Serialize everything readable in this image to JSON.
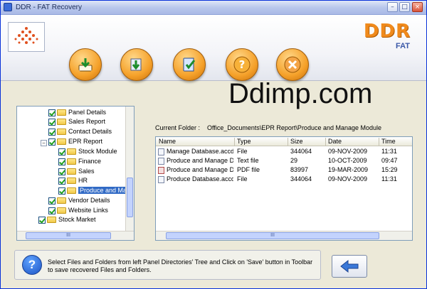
{
  "window": {
    "title": "DDR - FAT Recovery",
    "controls": {
      "minimize": "–",
      "maximize": "□",
      "close": "×"
    }
  },
  "brand": {
    "name": "DDR",
    "product": "FAT"
  },
  "toolbar": {
    "buttons": [
      {
        "name": "save-button",
        "icon": "save-download-icon"
      },
      {
        "name": "load-button",
        "icon": "import-arrow-icon"
      },
      {
        "name": "check-button",
        "icon": "notepad-check-icon"
      },
      {
        "name": "help-button",
        "icon": "question-mark-icon"
      },
      {
        "name": "exit-button",
        "icon": "close-x-icon"
      }
    ]
  },
  "watermark": "Ddimp.com",
  "tree": {
    "items": [
      {
        "label": "Panel Details"
      },
      {
        "label": "Sales Report"
      },
      {
        "label": "Contact Details"
      },
      {
        "label": "EPR Report"
      },
      {
        "label": "Stock Module"
      },
      {
        "label": "Finance"
      },
      {
        "label": "Sales"
      },
      {
        "label": "HR"
      },
      {
        "label": "Produce and Mar"
      },
      {
        "label": "Vendor Details"
      },
      {
        "label": "Website Links"
      },
      {
        "label": "Stock Market"
      }
    ],
    "scroll_grip": "III"
  },
  "current_folder": {
    "label": "Current Folder :",
    "path": "Office_Documents\\EPR Report\\Produce and Manage Module"
  },
  "file_list": {
    "columns": [
      "Name",
      "Type",
      "Size",
      "Date",
      "Time"
    ],
    "rows": [
      {
        "name": "Manage Database.accdb",
        "type": "File",
        "size": "344064",
        "date": "09-NOV-2009",
        "time": "11:31",
        "icon": "file-icon"
      },
      {
        "name": "Produce and Manage D...",
        "type": "Text file",
        "size": "29",
        "date": "10-OCT-2009",
        "time": "09:47",
        "icon": "text-file-icon"
      },
      {
        "name": "Produce and Manage D...",
        "type": "PDF file",
        "size": "83997",
        "date": "19-MAR-2009",
        "time": "15:29",
        "icon": "pdf-file-icon"
      },
      {
        "name": "Produce Database.accdb",
        "type": "File",
        "size": "344064",
        "date": "09-NOV-2009",
        "time": "11:31",
        "icon": "file-icon"
      }
    ],
    "scroll_grip": "III"
  },
  "help": {
    "icon": "?",
    "text": "Select Files and Folders from left Panel Directories' Tree and Click on 'Save' button in Toolbar to save recovered Files and Folders."
  },
  "colors": {
    "accent_orange": "#f5a12a",
    "selection_blue": "#316ac5",
    "brand_orange": "#f08a1c"
  }
}
